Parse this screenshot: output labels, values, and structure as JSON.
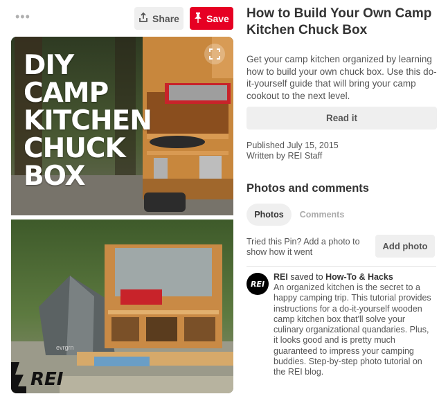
{
  "toolbar": {
    "more_glyph": "•••",
    "share_label": "Share",
    "save_label": "Save",
    "save_color": "#e60023"
  },
  "pin": {
    "overlay_text": [
      "DIY",
      "CAMP",
      "KITCHEN",
      "CHUCK",
      "BOX"
    ],
    "tent_text": "evrgrn",
    "logo_text": "REI",
    "expand_icon": "expand-icon"
  },
  "article": {
    "title": "How to Build Your Own Camp Kitchen Chuck Box",
    "description": "Get your camp kitchen organized by learning how to build your own chuck box. Use this do-it-yourself guide that will bring your camp cookout to the next level.",
    "read_label": "Read it",
    "published": "Published July 15, 2015",
    "author": "Written by REI Staff"
  },
  "photos_section": {
    "heading": "Photos and comments",
    "tabs": [
      "Photos",
      "Comments"
    ],
    "tried_text": "Tried this Pin? Add a photo to show how it went",
    "add_photo_label": "Add photo"
  },
  "activity": {
    "avatar_text": "REI",
    "user": "REI",
    "saved_to": "saved to",
    "board": "How-To & Hacks",
    "description": "An organized kitchen is the secret to a happy camping trip. This tutorial provides instructions for a do-it-yourself wooden camp kitchen box that'll solve your culinary organizational quandaries. Plus, it looks good and is pretty much guaranteed to impress your camping buddies. Step-by-step photo tutorial on the REI blog."
  }
}
